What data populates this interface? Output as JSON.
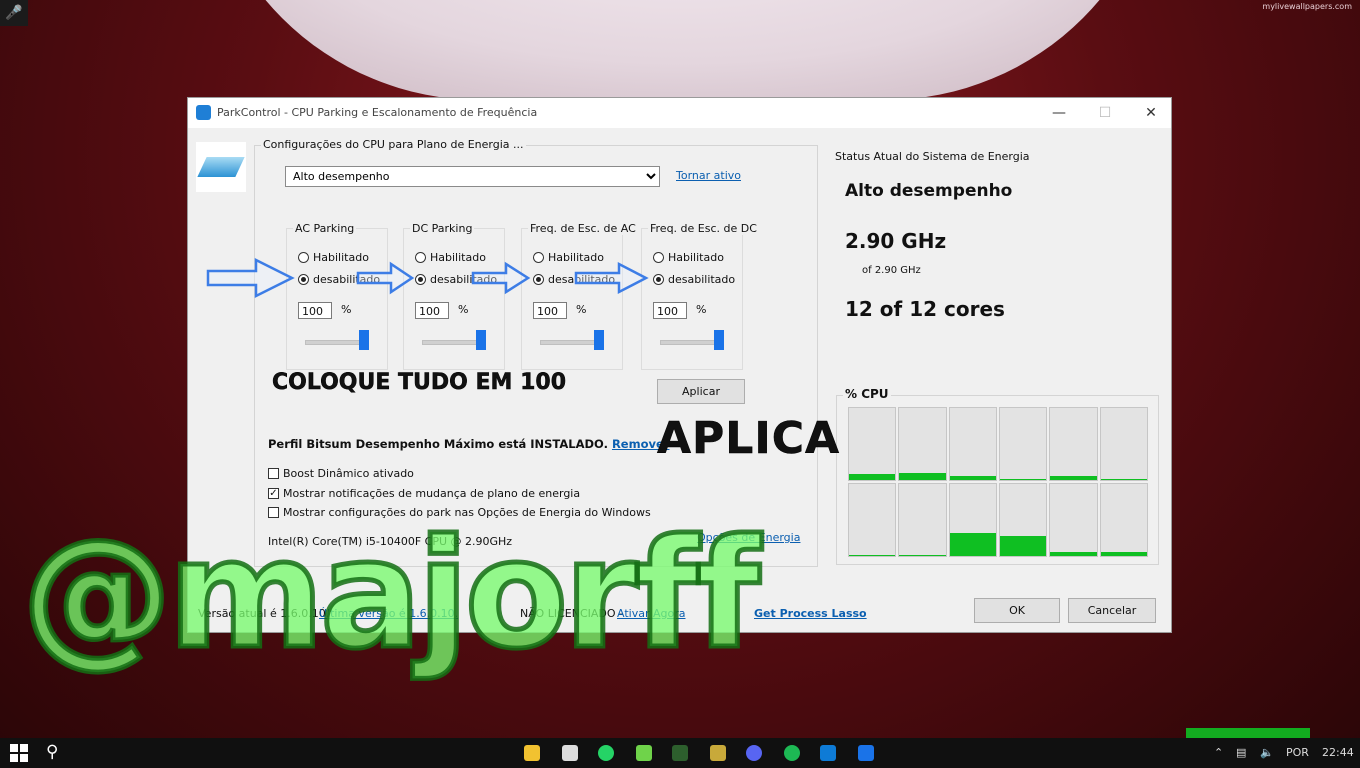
{
  "watermark_site": "mylivewallpapers.com",
  "window": {
    "title": "ParkControl - CPU Parking e Escalonamento de Frequência",
    "min_icon": "minimize-icon",
    "max_icon": "maximize-icon",
    "close_icon": "close-icon"
  },
  "config": {
    "legend": "Configurações do CPU para Plano de Energia ...",
    "plan_selected": "Alto desempenho",
    "make_active": "Tornar ativo",
    "groups": [
      {
        "title": "AC Parking",
        "opt1": "Habilitado",
        "opt2": "desabilitado",
        "selected": "desabilitado",
        "value": "100",
        "unit": "%",
        "slider_fraction": 1.0
      },
      {
        "title": "DC Parking",
        "opt1": "Habilitado",
        "opt2": "desabilitado",
        "selected": "desabilitado",
        "value": "100",
        "unit": "%",
        "slider_fraction": 1.0
      },
      {
        "title": "Freq. de Esc. de AC",
        "opt1": "Habilitado",
        "opt2": "desabilitado",
        "selected": "desabilitado",
        "value": "100",
        "unit": "%",
        "slider_fraction": 1.0
      },
      {
        "title": "Freq. de Esc. de DC",
        "opt1": "Habilitado",
        "opt2": "desabilitado",
        "selected": "desabilitado",
        "value": "100",
        "unit": "%",
        "slider_fraction": 1.0
      }
    ],
    "apply": "Aplicar",
    "profile_text": "Perfil Bitsum Desempenho Máximo está INSTALADO.",
    "remove": "Remover",
    "checks": [
      {
        "label": "Boost Dinâmico ativado",
        "checked": false
      },
      {
        "label": "Mostrar notificações de mudança de plano de energia",
        "checked": true
      },
      {
        "label": "Mostrar configurações do park nas Opções de Energia do Windows",
        "checked": false
      }
    ],
    "cpu_name": "Intel(R) Core(TM) i5-10400F CPU @ 2.90GHz",
    "power_options": "Opções de Energia"
  },
  "status": {
    "legend": "Status Atual do Sistema de Energia",
    "plan": "Alto desempenho",
    "freq": "2.90 GHz",
    "freq_of": "of 2.90 GHz",
    "cores": "12 of 12 cores",
    "cpu_label": "% CPU",
    "cpu_loads": [
      8,
      10,
      5,
      2,
      6,
      0,
      2,
      0,
      32,
      28,
      6,
      5
    ]
  },
  "footer": {
    "version": "Versão atual é 1.6.0.10.",
    "latest": "Última versão é 1.6.0.10.",
    "license": "NÃO LICENCIADO -",
    "activate": "Ativar Agora",
    "process_lasso": "Get Process Lasso",
    "ok": "OK",
    "cancel": "Cancelar"
  },
  "annotations": {
    "put_all": "COLOQUE TUDO EM 100",
    "apply": "APLICA",
    "handle": "@majorff"
  },
  "taskbar": {
    "language": "POR",
    "time": "22:44",
    "accent_green": "#0fbf22",
    "accent_blue": "#1a73e8"
  }
}
